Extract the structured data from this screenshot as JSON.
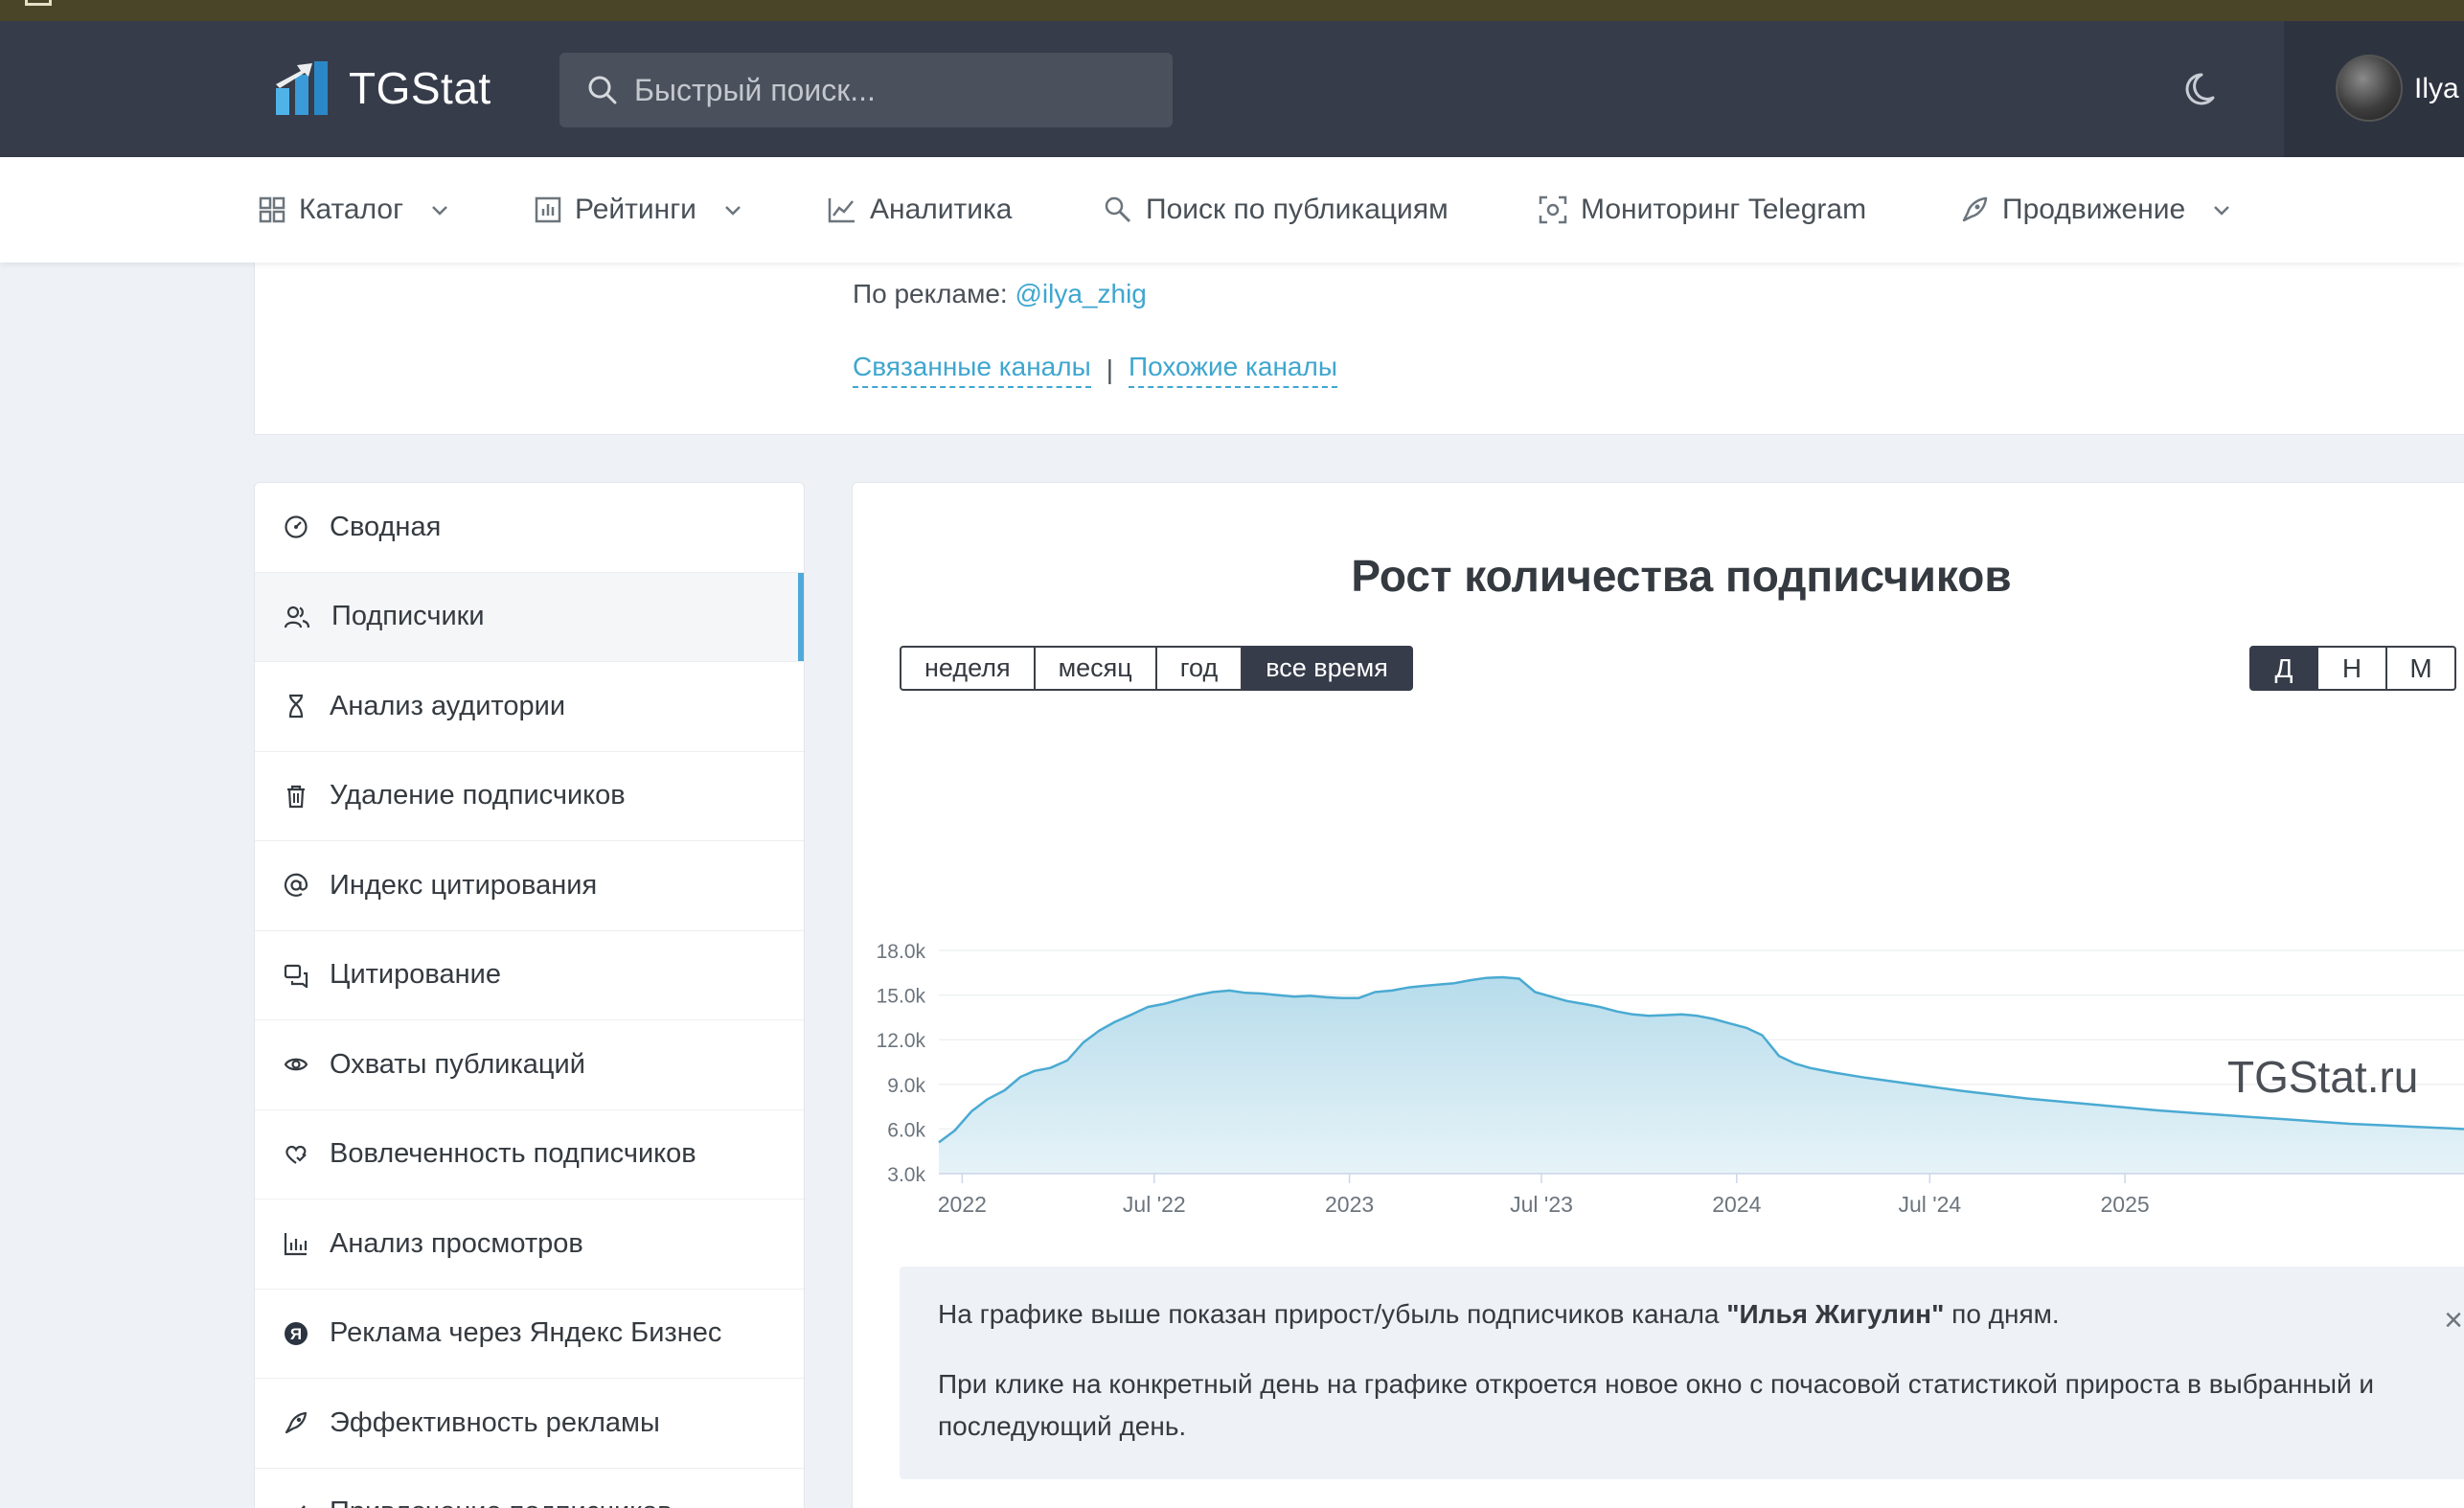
{
  "header": {
    "brand": "TGStat",
    "search_placeholder": "Быстрый поиск...",
    "user_name": "Ilya"
  },
  "nav": {
    "items": [
      {
        "label": "Каталог",
        "icon": "grid-icon",
        "dropdown": true
      },
      {
        "label": "Рейтинги",
        "icon": "bar-chart-icon",
        "dropdown": true
      },
      {
        "label": "Аналитика",
        "icon": "line-chart-icon",
        "dropdown": false
      },
      {
        "label": "Поиск по публикациям",
        "icon": "search-doc-icon",
        "dropdown": false
      },
      {
        "label": "Мониторинг Telegram",
        "icon": "monitor-icon",
        "dropdown": false
      },
      {
        "label": "Продвижение",
        "icon": "rocket-icon",
        "dropdown": true
      }
    ]
  },
  "channel": {
    "ad_label": "По рекламе:",
    "ad_contact": "@ilya_zhig",
    "related_link": "Связанные каналы",
    "similar_link": "Похожие каналы",
    "separator": "|"
  },
  "sidebar": {
    "items": [
      {
        "label": "Сводная",
        "icon": "dashboard-icon"
      },
      {
        "label": "Подписчики",
        "icon": "users-icon",
        "active": true
      },
      {
        "label": "Анализ аудитории",
        "icon": "hourglass-icon"
      },
      {
        "label": "Удаление подписчиков",
        "icon": "trash-icon"
      },
      {
        "label": "Индекс цитирования",
        "icon": "at-icon"
      },
      {
        "label": "Цитирование",
        "icon": "quote-icon"
      },
      {
        "label": "Охваты публикаций",
        "icon": "eye-icon"
      },
      {
        "label": "Вовлеченность подписчиков",
        "icon": "engagement-icon"
      },
      {
        "label": "Анализ просмотров",
        "icon": "views-chart-icon"
      },
      {
        "label": "Реклама через Яндекс Бизнес",
        "icon": "yandex-icon"
      },
      {
        "label": "Эффективность рекламы",
        "icon": "rocket-icon"
      },
      {
        "label": "Привлечение подписчиков",
        "icon": "check-icon"
      }
    ]
  },
  "main": {
    "title": "Рост количества подписчиков",
    "ranges": [
      "неделя",
      "месяц",
      "год",
      "все время"
    ],
    "active_range": "все время",
    "granularity": [
      "Д",
      "Н",
      "М"
    ],
    "active_granularity": "Д",
    "watermark": "TGStat.ru",
    "info": {
      "line1_prefix": "На графике выше показан прирост/убыль подписчиков канала ",
      "line1_channel": "\"Илья Жигулин\"",
      "line1_suffix": " по дням.",
      "line2": "При клике на конкретный день на графике откроется новое окно с почасовой статистикой прироста в выбранный и последующий день.",
      "close": "×"
    }
  },
  "colors": {
    "header_bg": "#363c4a",
    "accent": "#4fa9d8",
    "link": "#3fa6cf",
    "area_fill": "#cfe8f1",
    "line": "#4aaad2"
  },
  "chart_data": {
    "type": "area",
    "title": "Рост количества подписчиков",
    "xlabel": "",
    "ylabel": "",
    "x_ticks": [
      "2022",
      "Jul '22",
      "2023",
      "Jul '23",
      "2024",
      "Jul '24",
      "2025"
    ],
    "y_ticks": [
      "3.0k",
      "6.0k",
      "9.0k",
      "12.0k",
      "15.0k",
      "18.0k"
    ],
    "ylim": [
      3000,
      18000
    ],
    "xlim": [
      "2021-12-10",
      "2025-12-01"
    ],
    "grid": true,
    "legend": "none",
    "series": [
      {
        "x": [
          "2021-12-10",
          "2021-12-25",
          "2022-01-10",
          "2022-01-25",
          "2022-02-10",
          "2022-02-25",
          "2022-03-10",
          "2022-03-25",
          "2022-04-10",
          "2022-04-25",
          "2022-05-10",
          "2022-05-25",
          "2022-06-10",
          "2022-06-25",
          "2022-07-10",
          "2022-07-25",
          "2022-08-10",
          "2022-08-25",
          "2022-09-10",
          "2022-09-25",
          "2022-10-10",
          "2022-10-25",
          "2022-11-10",
          "2022-11-25",
          "2022-12-10",
          "2022-12-25",
          "2023-01-10",
          "2023-01-25",
          "2023-02-10",
          "2023-02-25",
          "2023-03-10",
          "2023-03-25",
          "2023-04-10",
          "2023-04-25",
          "2023-05-10",
          "2023-05-25",
          "2023-06-10",
          "2023-06-25",
          "2023-07-10",
          "2023-07-25",
          "2023-08-10",
          "2023-08-25",
          "2023-09-10",
          "2023-09-25",
          "2023-10-10",
          "2023-10-25",
          "2023-11-10",
          "2023-11-25",
          "2023-12-10",
          "2023-12-25",
          "2024-01-10",
          "2024-01-25",
          "2024-02-10",
          "2024-02-25",
          "2024-03-10",
          "2024-04-01",
          "2024-05-01",
          "2024-06-01",
          "2024-07-01",
          "2024-08-01",
          "2024-09-01",
          "2024-10-01",
          "2024-11-01",
          "2024-12-01",
          "2025-01-01",
          "2025-02-01",
          "2025-03-01",
          "2025-04-01",
          "2025-05-01",
          "2025-06-01",
          "2025-07-01",
          "2025-08-01",
          "2025-09-01",
          "2025-10-01",
          "2025-11-01",
          "2025-12-01"
        ],
        "values": [
          5100,
          5900,
          7200,
          8000,
          8600,
          9500,
          9900,
          10100,
          10600,
          11800,
          12600,
          13200,
          13700,
          14200,
          14400,
          14700,
          15000,
          15200,
          15300,
          15150,
          15100,
          15000,
          14900,
          14950,
          14850,
          14800,
          14800,
          15200,
          15300,
          15500,
          15600,
          15700,
          15800,
          16000,
          16150,
          16200,
          16100,
          15200,
          14900,
          14600,
          14400,
          14200,
          13900,
          13700,
          13600,
          13650,
          13700,
          13600,
          13400,
          13100,
          12800,
          12300,
          10900,
          10400,
          10100,
          9800,
          9450,
          9150,
          8850,
          8550,
          8300,
          8050,
          7850,
          7650,
          7450,
          7250,
          7100,
          6950,
          6800,
          6650,
          6500,
          6350,
          6250,
          6150,
          6050,
          5950
        ]
      }
    ]
  }
}
